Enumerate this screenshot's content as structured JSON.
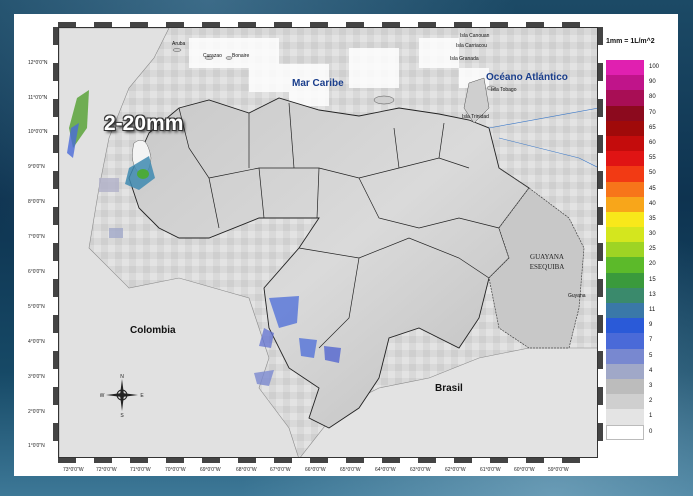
{
  "legend": {
    "title": "1mm = 1L/m^2",
    "items": [
      {
        "label": "100",
        "color": "#e020b0"
      },
      {
        "label": "90",
        "color": "#c0148a"
      },
      {
        "label": "80",
        "color": "#a80e55"
      },
      {
        "label": "70",
        "color": "#8c0a1e"
      },
      {
        "label": "65",
        "color": "#a00a0a"
      },
      {
        "label": "60",
        "color": "#c40c0c"
      },
      {
        "label": "55",
        "color": "#e01414"
      },
      {
        "label": "50",
        "color": "#f23a14"
      },
      {
        "label": "45",
        "color": "#f7751a"
      },
      {
        "label": "40",
        "color": "#f8a61a"
      },
      {
        "label": "35",
        "color": "#f8e81a"
      },
      {
        "label": "30",
        "color": "#d4e61e"
      },
      {
        "label": "25",
        "color": "#9ed424"
      },
      {
        "label": "20",
        "color": "#5cba2a"
      },
      {
        "label": "15",
        "color": "#3a9a3c"
      },
      {
        "label": "13",
        "color": "#3a8a6c"
      },
      {
        "label": "11",
        "color": "#3a78a8"
      },
      {
        "label": "9",
        "color": "#2a5ad8"
      },
      {
        "label": "7",
        "color": "#4a6ad8"
      },
      {
        "label": "5",
        "color": "#7888d0"
      },
      {
        "label": "4",
        "color": "#a0a8c8"
      },
      {
        "label": "3",
        "color": "#bcbcbc"
      },
      {
        "label": "2",
        "color": "#cfcfcf"
      },
      {
        "label": "1",
        "color": "#e4e4e4"
      },
      {
        "label": "0",
        "color": "#ffffff"
      }
    ]
  },
  "map": {
    "rain_label": "2-20mm",
    "sea_labels": {
      "caribbean": "Mar Caribe",
      "atlantic": "Océano Atlántico"
    },
    "countries": {
      "colombia": "Colombia",
      "brasil": "Brasil"
    },
    "guayana_line1": "GUAYANA",
    "guayana_line2": "ESEQUIBA",
    "guyana": "Guyana",
    "places": {
      "aruba": "Aruba",
      "curacao": "Curazao",
      "bonaire": "Bonaire",
      "carriacou": "Isla Carriacou",
      "canouan": "Isla Canouan",
      "grenada": "Isla Granada",
      "tobago": "Isla Tobago",
      "trinidad": "Isla Trinidad"
    },
    "latitudes": [
      "12°0'0\"N",
      "11°0'0\"N",
      "10°0'0\"N",
      "9°0'0\"N",
      "8°0'0\"N",
      "7°0'0\"N",
      "6°0'0\"N",
      "5°0'0\"N",
      "4°0'0\"N",
      "3°0'0\"N",
      "2°0'0\"N",
      "1°0'0\"N"
    ],
    "longitudes": [
      "73°0'0\"W",
      "72°0'0\"W",
      "71°0'0\"W",
      "70°0'0\"W",
      "69°0'0\"W",
      "68°0'0\"W",
      "67°0'0\"W",
      "66°0'0\"W",
      "65°0'0\"W",
      "64°0'0\"W",
      "63°0'0\"W",
      "62°0'0\"W",
      "61°0'0\"W",
      "60°0'0\"W",
      "59°0'0\"W"
    ],
    "compass": {
      "n": "N",
      "s": "S",
      "e": "E",
      "w": "W"
    }
  }
}
